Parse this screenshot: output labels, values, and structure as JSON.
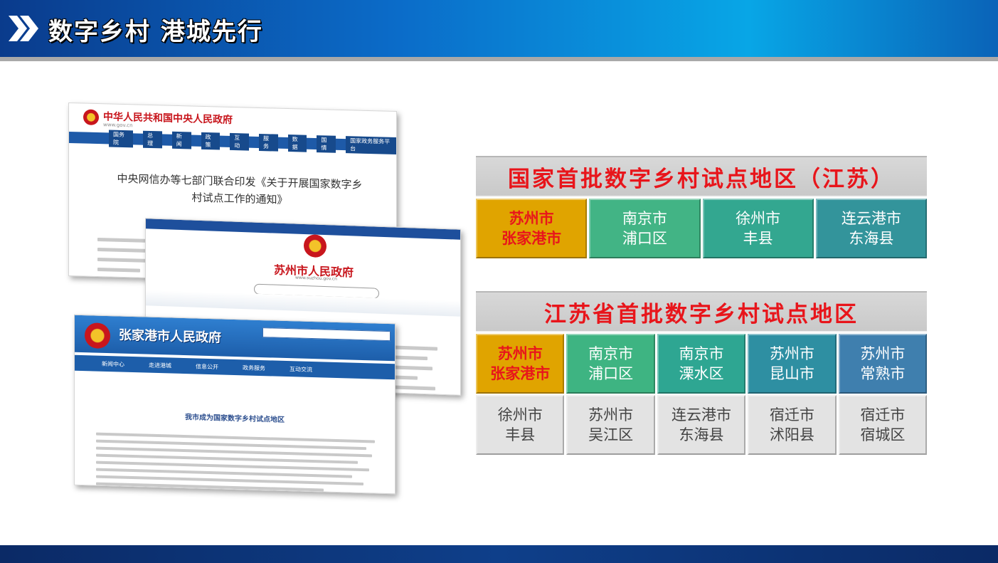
{
  "header": {
    "title": "数字乡村 港城先行"
  },
  "screenshots": {
    "gov": {
      "site_name": "中华人民共和国中央人民政府",
      "domain": "www.gov.cn",
      "nav": [
        "国务院",
        "总理",
        "新闻",
        "政策",
        "互动",
        "服务",
        "数据",
        "国情",
        "国家政务服务平台"
      ],
      "headline_line1": "中央网信办等七部门联合印发《关于开展国家数字乡",
      "headline_line2": "村试点工作的通知》"
    },
    "suzhou": {
      "site_name": "苏州市人民政府",
      "domain": "www.suzhou.gov.cn"
    },
    "zjg": {
      "site_name": "张家港市人民政府",
      "nav": [
        "新闻中心",
        "走进港城",
        "信息公开",
        "政务服务",
        "互动交流"
      ],
      "headline": "我市成为国家数字乡村试点地区"
    }
  },
  "national_table": {
    "title": "国家首批数字乡村试点地区（江苏）",
    "cells": [
      {
        "line1": "苏州市",
        "line2": "张家港市",
        "bg": "#e0a400",
        "highlight": true
      },
      {
        "line1": "南京市",
        "line2": "浦口区",
        "bg": "#42b485"
      },
      {
        "line1": "徐州市",
        "line2": "丰县",
        "bg": "#33a790"
      },
      {
        "line1": "连云港市",
        "line2": "东海县",
        "bg": "#33949b"
      }
    ]
  },
  "provincial_table": {
    "title": "江苏省首批数字乡村试点地区",
    "row1": [
      {
        "line1": "苏州市",
        "line2": "张家港市",
        "bg": "#e0a400",
        "highlight": true
      },
      {
        "line1": "南京市",
        "line2": "浦口区",
        "bg": "#3eb482"
      },
      {
        "line1": "南京市",
        "line2": "溧水区",
        "bg": "#2ea692"
      },
      {
        "line1": "苏州市",
        "line2": "昆山市",
        "bg": "#2e8fa2"
      },
      {
        "line1": "苏州市",
        "line2": "常熟市",
        "bg": "#3f7fae"
      }
    ],
    "row2": [
      {
        "line1": "徐州市",
        "line2": "丰县",
        "bg": "#e3e3e3"
      },
      {
        "line1": "苏州市",
        "line2": "吴江区",
        "bg": "#e3e3e3"
      },
      {
        "line1": "连云港市",
        "line2": "东海县",
        "bg": "#e3e3e3"
      },
      {
        "line1": "宿迁市",
        "line2": "沭阳县",
        "bg": "#e3e3e3"
      },
      {
        "line1": "宿迁市",
        "line2": "宿城区",
        "bg": "#e3e3e3"
      }
    ]
  }
}
